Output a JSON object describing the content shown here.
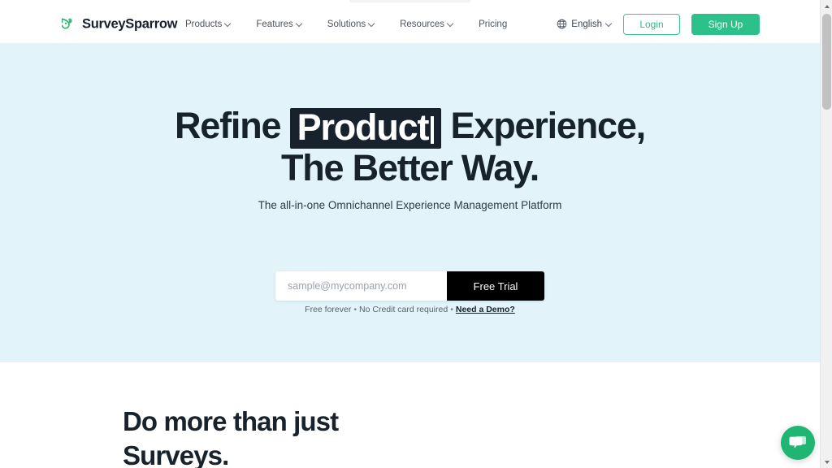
{
  "header": {
    "logo": {
      "icon": "sparrow-logo-icon",
      "text": "SurveySparrow"
    },
    "nav": [
      {
        "label": "Products",
        "has_dropdown": true
      },
      {
        "label": "Features",
        "has_dropdown": true
      },
      {
        "label": "Solutions",
        "has_dropdown": true
      },
      {
        "label": "Resources",
        "has_dropdown": true
      },
      {
        "label": "Pricing",
        "has_dropdown": false
      }
    ],
    "language": {
      "icon": "globe-icon",
      "label": "English",
      "has_dropdown": true
    },
    "login_label": "Login",
    "signup_label": "Sign Up"
  },
  "hero": {
    "title_prefix": "Refine",
    "title_highlight": "Product",
    "title_suffix": "Experience,",
    "title_line2": "The Better Way.",
    "subtitle": "The all-in-one Omnichannel Experience Management Platform",
    "email_placeholder": "sample@mycompany.com",
    "email_value": "",
    "cta_label": "Free Trial",
    "note_part1": "Free forever",
    "note_part2": "No Credit card required",
    "note_link": "Need a Demo?",
    "note_separator": "•"
  },
  "section": {
    "title_line1": "Do more than just",
    "title_line2": "Surveys."
  },
  "chat": {
    "icon": "chat-bubbles-icon",
    "label": "Chat"
  },
  "scrollbar": {
    "up_icon": "scroll-up-arrow-icon",
    "down_icon": "scroll-down-arrow-icon"
  },
  "colors": {
    "brand_green": "#2cc08a",
    "chat_green": "#20b573",
    "hero_bg": "#e2f4fa",
    "dark": "#17222c",
    "cta_black": "#000000"
  }
}
